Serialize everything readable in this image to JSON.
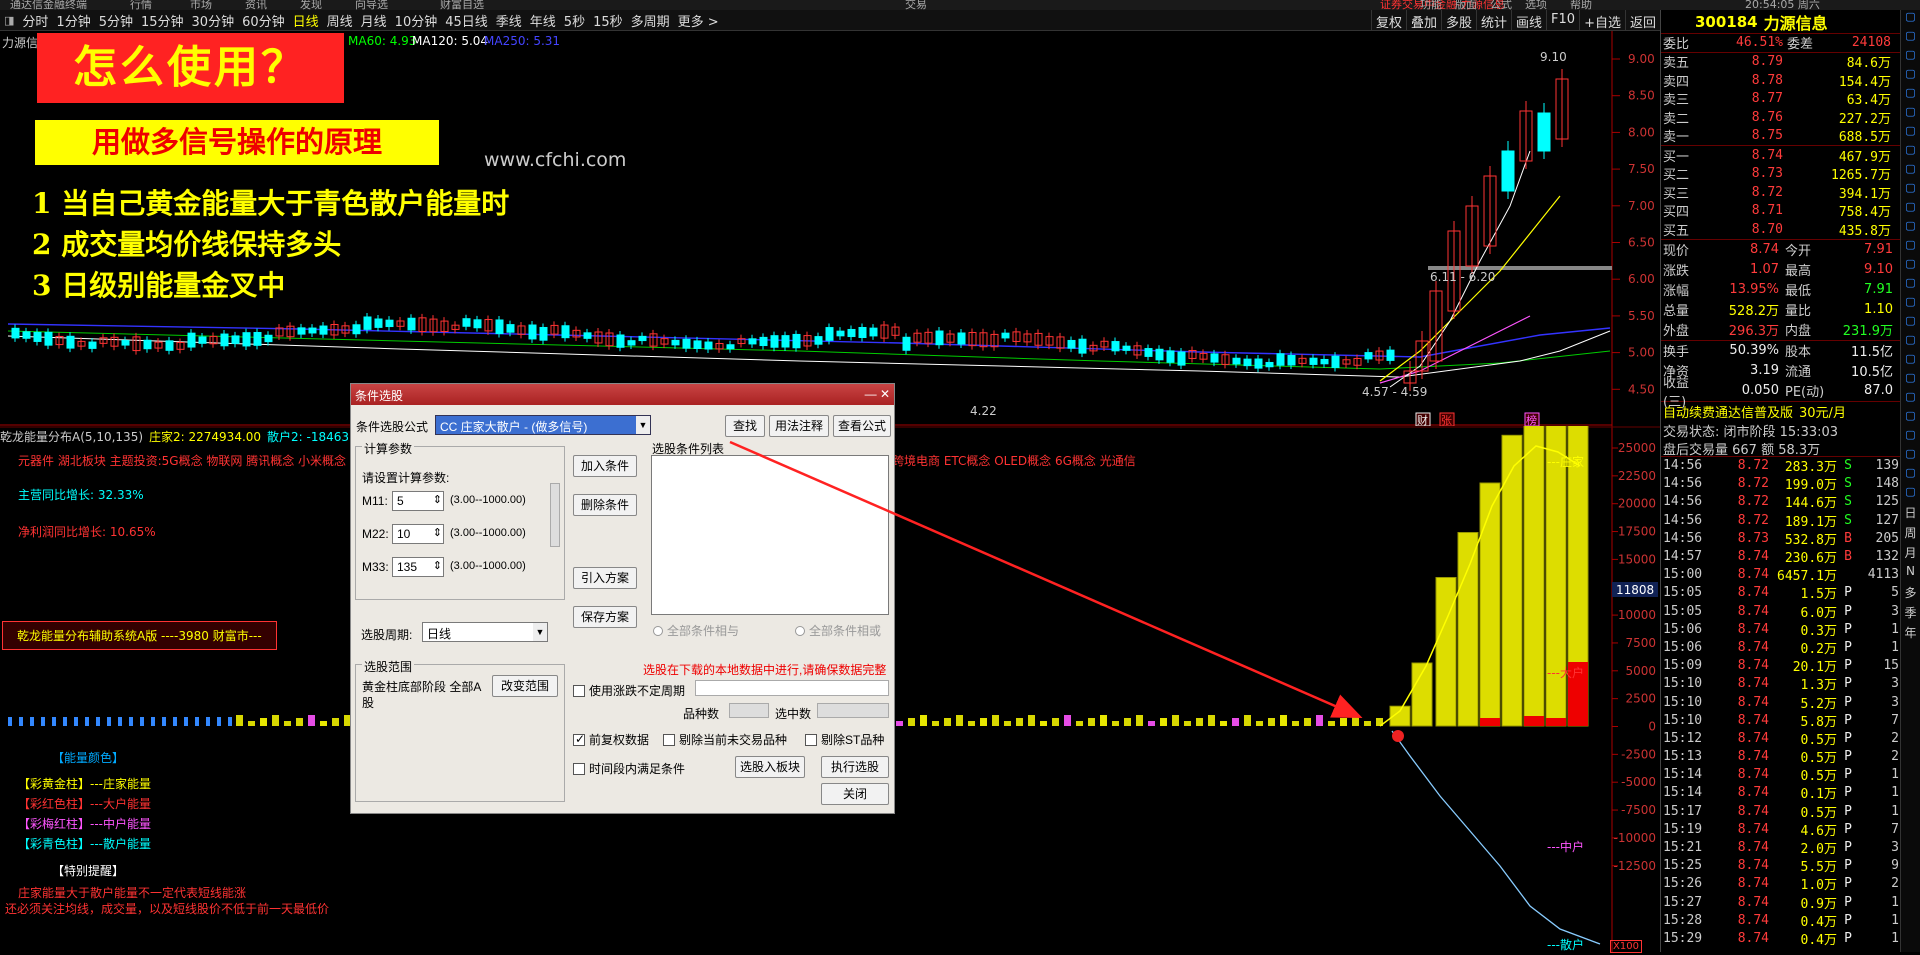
{
  "topbar": {
    "items": [
      "通达信金融终端",
      "行情",
      "市场",
      "资讯",
      "发现",
      "向导选",
      "财富自选",
      "交易",
      "证券交易中金融-力源信息",
      "功能",
      "版面",
      "公式",
      "选项",
      "帮助",
      "20:54:05 周六"
    ]
  },
  "periods": [
    "分时",
    "1分钟",
    "5分钟",
    "15分钟",
    "30分钟",
    "60分钟",
    "日线",
    "周线",
    "月线",
    "10分钟",
    "45日线",
    "季线",
    "年线",
    "5秒",
    "15秒",
    "多周期",
    "更多 >"
  ],
  "active_period": "日线",
  "tools": [
    "复权",
    "叠加",
    "多股",
    "统计",
    "画线",
    "F10",
    "+自选",
    "返回"
  ],
  "chart": {
    "stock_label": "力源信",
    "ma60": "MA60: 4.93",
    "ma120": "MA120: 5.04",
    "ma250": "MA250: 5.31",
    "price_axis": [
      "9.00",
      "8.50",
      "8.00",
      "7.50",
      "7.00",
      "6.50",
      "6.00",
      "5.50",
      "5.00",
      "4.50"
    ],
    "high_label": "9.10",
    "range_label": "6.11 - 6.20",
    "low_range": "4.57 - 4.59",
    "low_point": "4.22",
    "markers": [
      "财",
      "张",
      "榜"
    ],
    "watermark": "www.cfchi.com"
  },
  "overlay": {
    "title": "怎么使用？",
    "subtitle": "用做多信号操作的原理",
    "points": [
      "1 当自己黄金能量大于青色散户能量时",
      "2 成交量均价线保持多头",
      "3 日级别能量金叉中"
    ]
  },
  "indicator": {
    "header": "乾龙能量分布A(5,10,135)",
    "zhuangjia": "庄家2: 2274934.00",
    "sanhu": "散户2: -184631",
    "concepts": "元器件 湖北板块 主题投资:5G概念 物联网 腾讯概念 小米概念 华为概念",
    "concepts_right": "跨境电商 ETC概念 OLED概念 6G概念 光通信",
    "main_growth": "主营同比增长: 32.33%",
    "profit_growth": "净利润同比增长: 10.65%",
    "system_box": "乾龙能量分布辅助系统A版 ----3980 财富市---",
    "legend_title": "【能量颜色】",
    "legend": [
      "【彩黄金柱】---庄家能量",
      "【彩红色柱】---大户能量",
      "【彩梅红柱】---中户能量",
      "【彩青色柱】---散户能量"
    ],
    "warn_title": "【特别提醒】",
    "warn_lines": [
      "庄家能量大于散户能量不一定代表短线能涨",
      "还必须关注均线，成交量，以及短线股价不低于前一天最低价"
    ],
    "axis": [
      "25000",
      "22500",
      "20000",
      "17500",
      "15000",
      "12500",
      "10000",
      "7500",
      "5000",
      "2500",
      "0",
      "-2500",
      "-5000",
      "-7500",
      "-10000",
      "-12500"
    ],
    "axis_hl": "11808",
    "series_labels": [
      "庄家",
      "大户",
      "中户",
      "散户"
    ],
    "x100": "X100"
  },
  "quote": {
    "code": "300184",
    "name": "力源信息",
    "weibi_label": "委比",
    "weibi": "46.51%",
    "weicha_label": "委差",
    "weicha": "24108",
    "asks": [
      [
        "卖五",
        "8.79",
        "84.6万"
      ],
      [
        "卖四",
        "8.78",
        "154.4万"
      ],
      [
        "卖三",
        "8.77",
        "63.4万"
      ],
      [
        "卖二",
        "8.76",
        "227.2万"
      ],
      [
        "卖一",
        "8.75",
        "688.5万"
      ]
    ],
    "bids": [
      [
        "买一",
        "8.74",
        "467.9万"
      ],
      [
        "买二",
        "8.73",
        "1265.7万"
      ],
      [
        "买三",
        "8.72",
        "394.1万"
      ],
      [
        "买四",
        "8.71",
        "758.4万"
      ],
      [
        "买五",
        "8.70",
        "435.8万"
      ]
    ],
    "stats": [
      [
        "现价",
        "8.74",
        "今开",
        "7.91"
      ],
      [
        "涨跌",
        "1.07",
        "最高",
        "9.10"
      ],
      [
        "涨幅",
        "13.95%",
        "最低",
        "7.91"
      ],
      [
        "总量",
        "528.2万",
        "量比",
        "1.10"
      ],
      [
        "外盘",
        "296.3万",
        "内盘",
        "231.9万"
      ]
    ],
    "stats2": [
      [
        "换手",
        "50.39%",
        "股本",
        "11.5亿"
      ],
      [
        "净资",
        "3.19",
        "流通",
        "10.5亿"
      ],
      [
        "收益(三)",
        "0.050",
        "PE(动)",
        "87.0"
      ]
    ],
    "promo": "自动续费通达信普及版",
    "promo_price": "30元/月",
    "trade_status": "交易状态: 闭市阶段 15:33:03",
    "after_hours": "盘后交易量 667 额 58.3万",
    "ticks": [
      [
        "14:56",
        "8.72",
        "283.3万",
        "S",
        "139"
      ],
      [
        "14:56",
        "8.72",
        "199.0万",
        "S",
        "148"
      ],
      [
        "14:56",
        "8.72",
        "144.6万",
        "S",
        "125"
      ],
      [
        "14:56",
        "8.72",
        "189.1万",
        "S",
        "127"
      ],
      [
        "14:56",
        "8.73",
        "532.8万",
        "B",
        "205"
      ],
      [
        "14:57",
        "8.74",
        "230.6万",
        "B",
        "132"
      ],
      [
        "15:00",
        "8.74",
        "6457.1万",
        "",
        "4113"
      ],
      [
        "15:05",
        "8.74",
        "1.5万",
        "P",
        "5"
      ],
      [
        "15:05",
        "8.74",
        "6.0万",
        "P",
        "3"
      ],
      [
        "15:06",
        "8.74",
        "0.3万",
        "P",
        "1"
      ],
      [
        "15:06",
        "8.74",
        "0.2万",
        "P",
        "1"
      ],
      [
        "15:09",
        "8.74",
        "20.1万",
        "P",
        "15"
      ],
      [
        "15:10",
        "8.74",
        "1.3万",
        "P",
        "3"
      ],
      [
        "15:10",
        "8.74",
        "5.2万",
        "P",
        "3"
      ],
      [
        "15:10",
        "8.74",
        "5.8万",
        "P",
        "7"
      ],
      [
        "15:12",
        "8.74",
        "0.5万",
        "P",
        "2"
      ],
      [
        "15:13",
        "8.74",
        "0.5万",
        "P",
        "2"
      ],
      [
        "15:14",
        "8.74",
        "0.5万",
        "P",
        "1"
      ],
      [
        "15:14",
        "8.74",
        "0.1万",
        "P",
        "1"
      ],
      [
        "15:17",
        "8.74",
        "0.5万",
        "P",
        "1"
      ],
      [
        "15:19",
        "8.74",
        "4.6万",
        "P",
        "7"
      ],
      [
        "15:21",
        "8.74",
        "2.0万",
        "P",
        "3"
      ],
      [
        "15:25",
        "8.74",
        "5.5万",
        "P",
        "9"
      ],
      [
        "15:26",
        "8.74",
        "1.0万",
        "P",
        "2"
      ],
      [
        "15:27",
        "8.74",
        "0.9万",
        "P",
        "1"
      ],
      [
        "15:28",
        "8.74",
        "0.4万",
        "P",
        "1"
      ],
      [
        "15:29",
        "8.74",
        "0.4万",
        "P",
        "1"
      ]
    ]
  },
  "side_labels": [
    "日",
    "周",
    "月",
    "N",
    "多",
    "季",
    "年"
  ],
  "dialog": {
    "title": "条件选股",
    "formula_label": "条件选股公式",
    "formula_value": "CC 庄家大散户 - (做多信号)",
    "find": "查找",
    "usage": "用法注释",
    "view": "查看公式",
    "calc_group": "计算参数",
    "calc_hint": "请设置计算参数:",
    "params": [
      [
        "M11:",
        "5",
        "(3.00--1000.00)"
      ],
      [
        "M22:",
        "10",
        "(3.00--1000.00)"
      ],
      [
        "M33:",
        "135",
        "(3.00--1000.00)"
      ]
    ],
    "add": "加入条件",
    "del": "删除条件",
    "import": "引入方案",
    "save": "保存方案",
    "list_label": "选股条件列表",
    "all_and": "全部条件相与",
    "all_or": "全部条件相或",
    "period_label": "选股周期:",
    "period_value": "日线",
    "range_group": "选股范围",
    "range_text": "黄金柱底部阶段 全部A股",
    "change_range": "改变范围",
    "warning": "选股在下载的本地数据中进行,请确保数据完整",
    "use_irregular": "使用涨跌不定周期",
    "count_label": "品种数",
    "picked_label": "选中数",
    "fq": "前复权数据",
    "exclude_stop": "剔除当前未交易品种",
    "exclude_st": "剔除ST品种",
    "period_all": "时间段内满足条件",
    "to_board": "选股入板块",
    "execute": "执行选股",
    "close": "关闭"
  }
}
